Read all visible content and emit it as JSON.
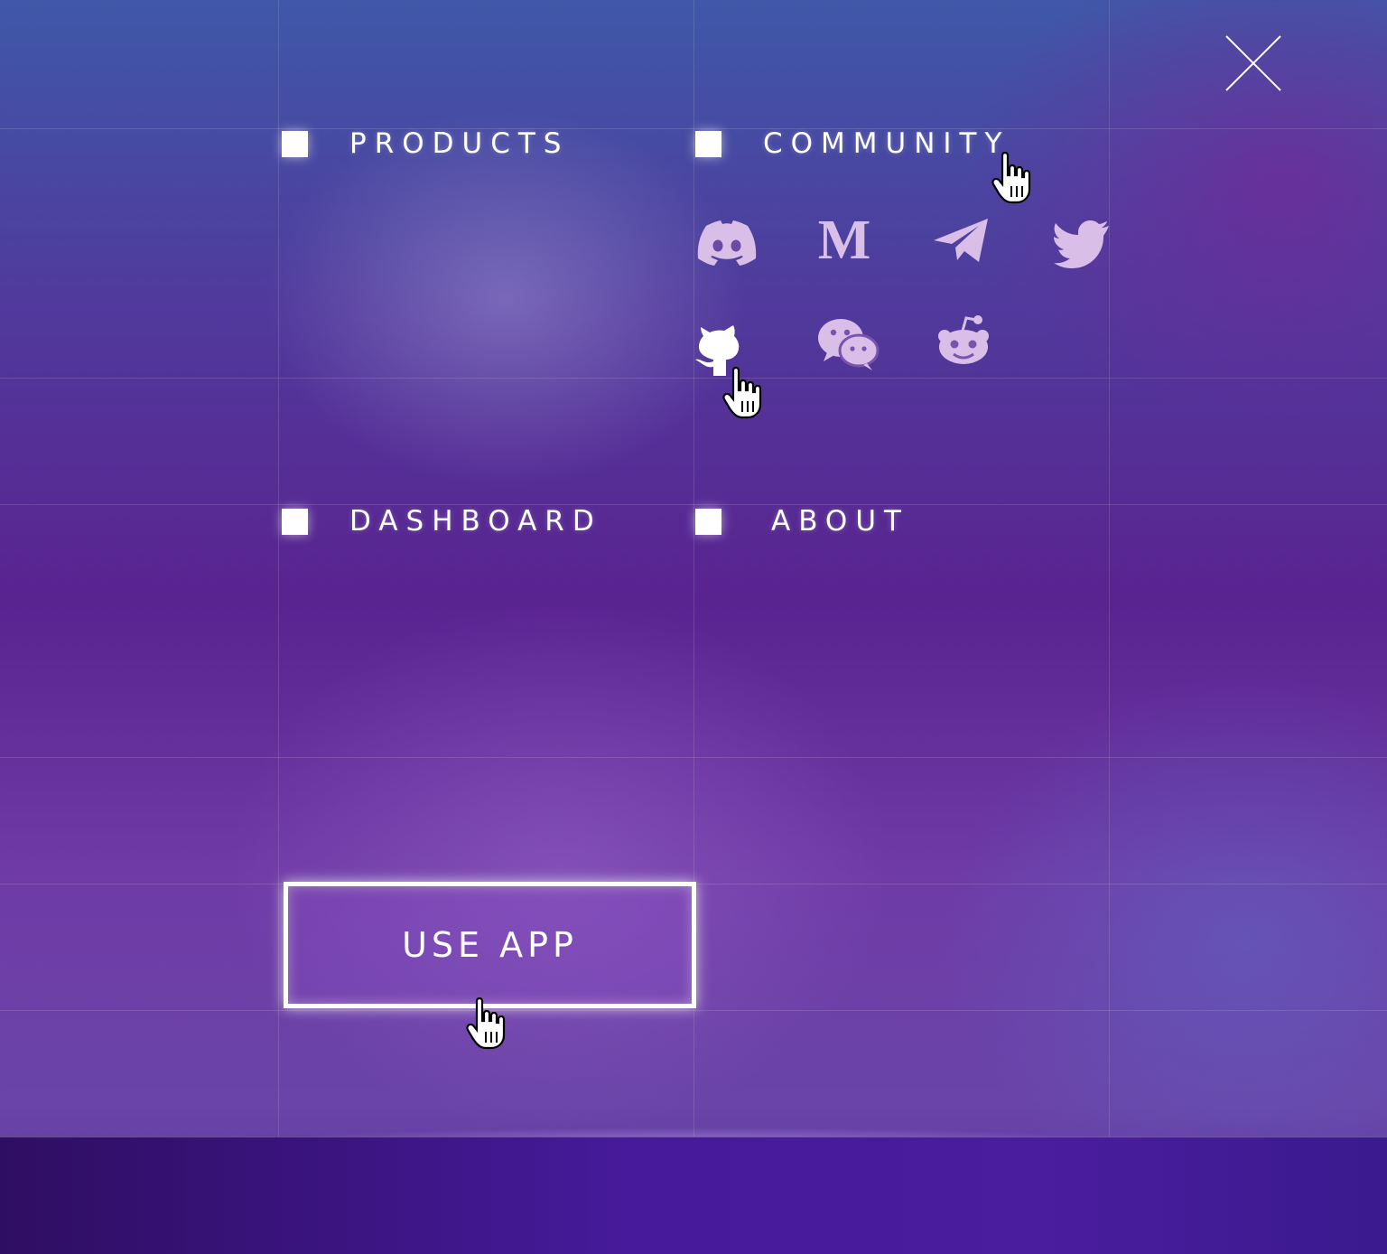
{
  "menu": {
    "close_icon": "close-icon",
    "items": [
      {
        "label": "PRODUCTS"
      },
      {
        "label": "COMMUNITY"
      },
      {
        "label": "DASHBOARD"
      },
      {
        "label": "ABOUT"
      }
    ]
  },
  "community": {
    "icons": [
      "discord-icon",
      "medium-icon",
      "telegram-icon",
      "twitter-icon",
      "github-icon",
      "wechat-icon",
      "reddit-icon"
    ]
  },
  "cta": {
    "label": "USE APP"
  },
  "colors": {
    "accent": "#ffffff",
    "icon_muted": "#d9bfe8",
    "background_top": "#3f58a8",
    "background_mid": "#5a2390",
    "footer": "#461a9a"
  }
}
